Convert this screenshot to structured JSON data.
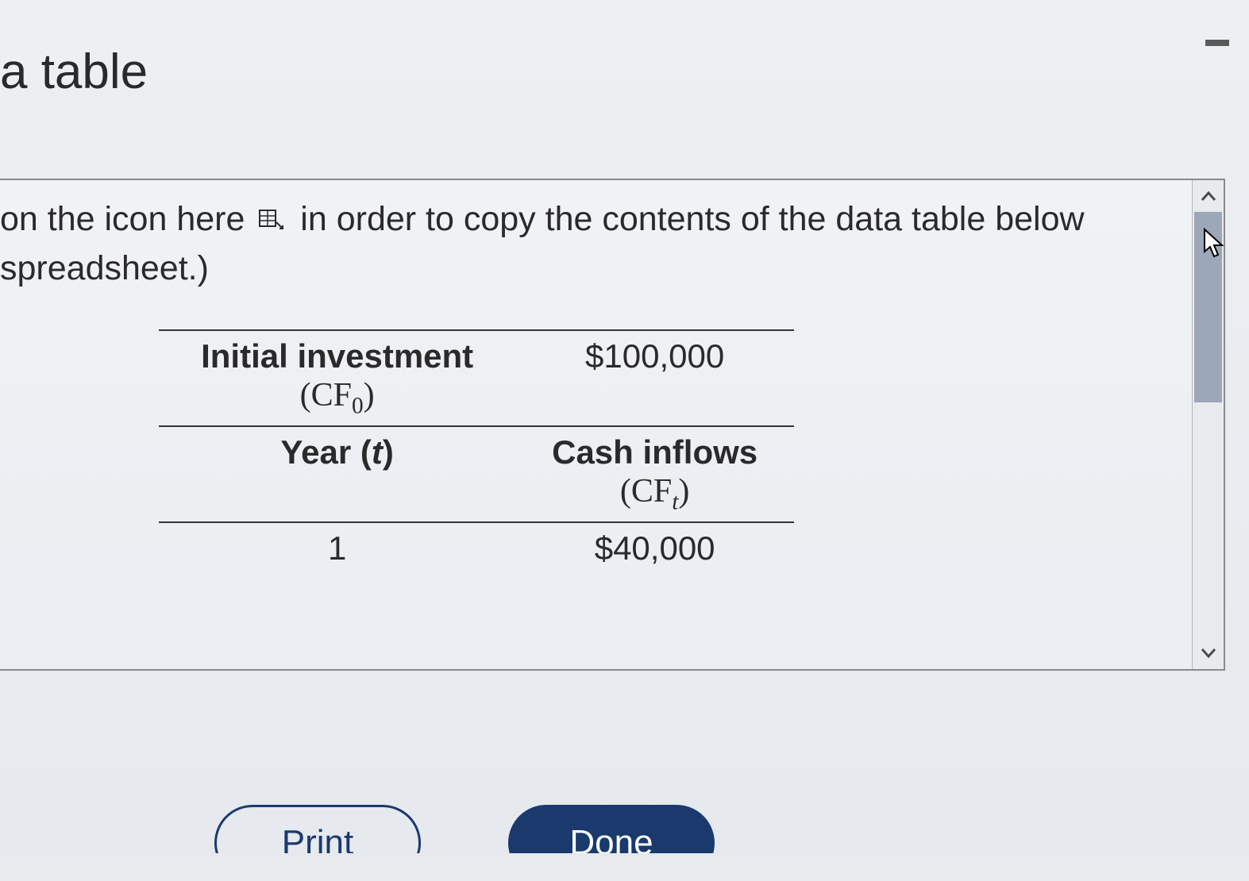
{
  "title": "a table",
  "instruction": {
    "part1": "on the icon here",
    "part2": "in order to copy the contents of the data table below",
    "part3": "spreadsheet.)"
  },
  "table": {
    "initial_investment_label": "Initial investment",
    "initial_investment_sub": "(CF",
    "initial_investment_sub_idx": "0",
    "initial_investment_sub_close": ")",
    "initial_investment_value": "$100,000",
    "year_label": "Year (",
    "year_var": "t",
    "year_label_close": ")",
    "cash_inflows_label": "Cash inflows",
    "cash_inflows_sub": "(CF",
    "cash_inflows_sub_idx": "t",
    "cash_inflows_sub_close": ")",
    "rows": [
      {
        "year": "1",
        "inflow": "$40,000"
      }
    ]
  },
  "buttons": {
    "print": "Print",
    "done": "Done"
  },
  "chart_data": {
    "type": "table",
    "title": "a table",
    "columns": [
      "Year (t)",
      "Cash inflows (CF_t)"
    ],
    "initial_investment_CF0": 100000,
    "rows": [
      {
        "year": 1,
        "cash_inflow": 40000
      }
    ]
  }
}
